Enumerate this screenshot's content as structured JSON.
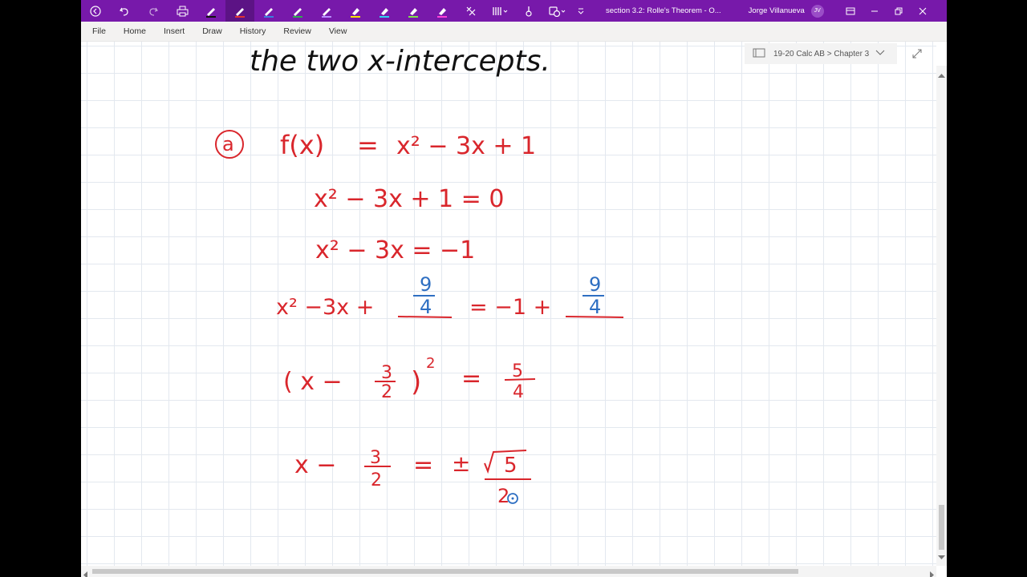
{
  "titlebar": {
    "doc_title": "section 3.2: Rolle's Theorem  -  O...",
    "user_name": "Jorge Villanueva",
    "user_initials": "JV",
    "accent": "#7719aa"
  },
  "menu": {
    "items": [
      "File",
      "Home",
      "Insert",
      "Draw",
      "History",
      "Review",
      "View"
    ]
  },
  "notebook": {
    "breadcrumb": "19-20 Calc AB > Chapter 3"
  },
  "ink": {
    "color_red": "#d9262c",
    "color_blue": "#2e6fc2",
    "color_black": "#111111",
    "header_text": "the two x-intercepts.",
    "part_label": "a",
    "line1_lhs": "f(x)",
    "line1_eq": "=",
    "line1_rhs": "x² − 3x + 1",
    "line2": "x² − 3x + 1 = 0",
    "line3": "x² − 3x = −1",
    "line4_lhs": "x² −3x +",
    "line4_mid": "= −1 +",
    "frac_9_4_num": "9",
    "frac_9_4_den": "4",
    "line5_left": "( x −",
    "line5_paren": ")",
    "line5_exp": "2",
    "line5_eq": "=",
    "frac_3_2_num": "3",
    "frac_3_2_den": "2",
    "frac_5_4_num": "5",
    "frac_5_4_den": "4",
    "line6_left": "x −",
    "line6_eq": "=",
    "line6_pm": "±",
    "sqrt_arg": "5",
    "line6_den": "2"
  }
}
